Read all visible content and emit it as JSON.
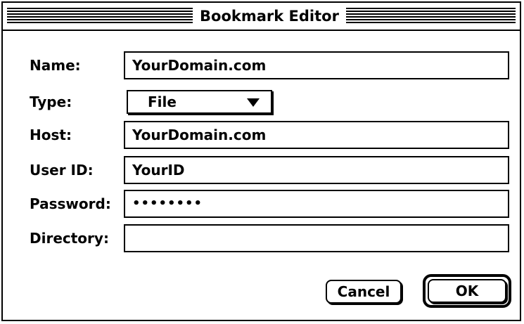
{
  "window": {
    "title": "Bookmark Editor"
  },
  "form": {
    "name": {
      "label": "Name:",
      "value": "YourDomain.com"
    },
    "type": {
      "label": "Type:",
      "value": "File"
    },
    "host": {
      "label": "Host:",
      "value": "YourDomain.com"
    },
    "user_id": {
      "label": "User ID:",
      "value": "YourID"
    },
    "password": {
      "label": "Password:",
      "value": "••••••••"
    },
    "directory": {
      "label": "Directory:",
      "value": ""
    }
  },
  "buttons": {
    "cancel": "Cancel",
    "ok": "OK"
  }
}
